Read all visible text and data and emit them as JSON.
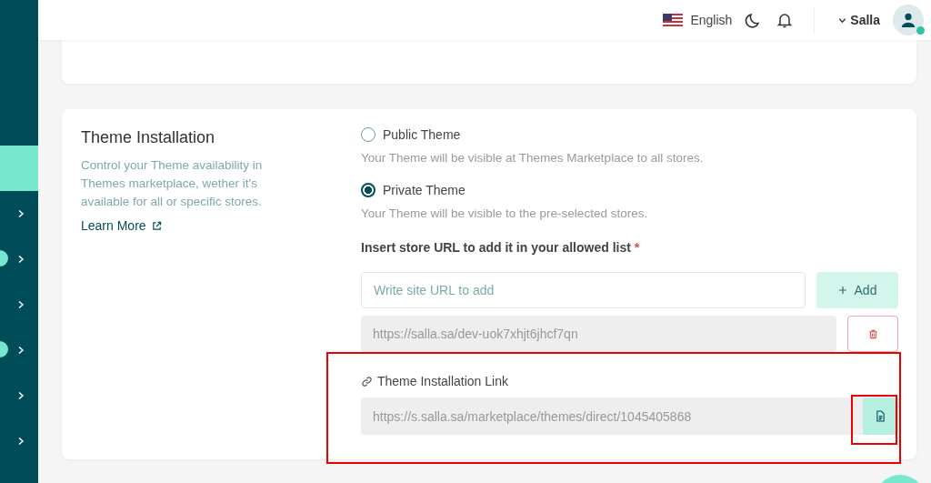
{
  "header": {
    "language": "English",
    "user": "Salla",
    "user_online": true
  },
  "sidebar": {
    "items": [
      {
        "selected": true,
        "expandable": false,
        "dot": false
      },
      {
        "selected": false,
        "expandable": true,
        "dot": false
      },
      {
        "selected": false,
        "expandable": true,
        "dot": true
      },
      {
        "selected": false,
        "expandable": true,
        "dot": false
      },
      {
        "selected": false,
        "expandable": true,
        "dot": true
      },
      {
        "selected": false,
        "expandable": true,
        "dot": false
      },
      {
        "selected": false,
        "expandable": true,
        "dot": false
      }
    ]
  },
  "section": {
    "title": "Theme Installation",
    "description": "Control your Theme availability in Themes marketplace, wether it's available for all or specific stores.",
    "learn_more": "Learn More"
  },
  "options": [
    {
      "label": "Public Theme",
      "hint": "Your Theme will be visible at Themes Marketplace to all stores.",
      "selected": false
    },
    {
      "label": "Private Theme",
      "hint": "Your Theme will be visible to the pre-selected stores.",
      "selected": true
    }
  ],
  "allowed_list": {
    "label": "Insert store URL to add it in your allowed list",
    "required": "*",
    "placeholder": "Write site URL to add",
    "add_button": "Add",
    "urls": [
      "https://salla.sa/dev-uok7xhjt6jhcf7qn"
    ]
  },
  "install_link": {
    "label": "Theme Installation Link",
    "value": "https://s.salla.sa/marketplace/themes/direct/1045405868"
  }
}
